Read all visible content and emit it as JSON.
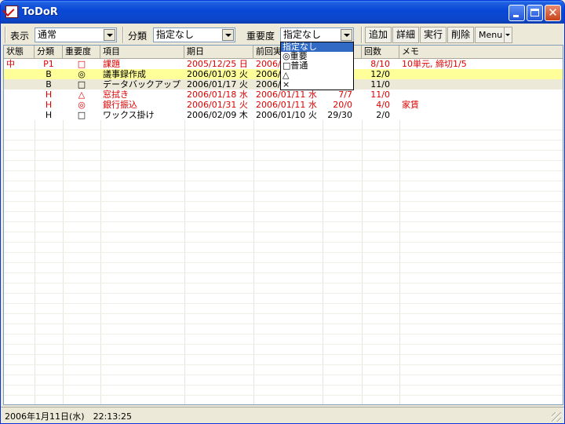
{
  "window": {
    "title": "ToDoR"
  },
  "toolbar": {
    "display_label": "表示",
    "display_value": "通常",
    "category_label": "分類",
    "category_value": "指定なし",
    "importance_label": "重要度",
    "importance_value": "指定なし",
    "add_label": "追加",
    "detail_label": "詳細",
    "run_label": "実行",
    "delete_label": "削除",
    "menu_label": "Menu"
  },
  "importance_dropdown": {
    "options": [
      "指定なし",
      "◎重要",
      "□普通",
      "△",
      "×"
    ]
  },
  "table": {
    "columns": [
      "状態",
      "分類",
      "重要度",
      "項目",
      "期日",
      "前回実",
      "",
      "回数",
      "メモ"
    ],
    "rows": [
      {
        "status": "中",
        "category": "P1",
        "importance": "□",
        "item": "課題",
        "due": "2005/12/25 日",
        "last": "2006/",
        "progress": "",
        "count": "8/10",
        "memo": "10単元, 締切1/5",
        "color": "#e00000",
        "bg": "#ffffff"
      },
      {
        "status": "",
        "category": "B",
        "importance": "◎",
        "item": "議事録作成",
        "due": "2006/01/03 火",
        "last": "2006/",
        "progress": "",
        "count": "12/0",
        "memo": "",
        "color": "#000000",
        "bg": "#ffff99"
      },
      {
        "status": "",
        "category": "B",
        "importance": "□",
        "item": "データバックアップ",
        "due": "2006/01/17 火",
        "last": "2006/",
        "progress": "",
        "count": "11/0",
        "memo": "",
        "color": "#000000",
        "bg": "#ece9d8"
      },
      {
        "status": "",
        "category": "H",
        "importance": "△",
        "item": "窓拭き",
        "due": "2006/01/18 水",
        "last": "2006/01/11 水",
        "progress": "7/7",
        "count": "11/0",
        "memo": "",
        "color": "#e00000",
        "bg": "#ffffff"
      },
      {
        "status": "",
        "category": "H",
        "importance": "◎",
        "item": "銀行振込",
        "due": "2006/01/31 火",
        "last": "2006/01/11 水",
        "progress": "20/0",
        "count": "4/0",
        "memo": "家賃",
        "color": "#e00000",
        "bg": "#ffffff"
      },
      {
        "status": "",
        "category": "H",
        "importance": "□",
        "item": "ワックス掛け",
        "due": "2006/02/09 木",
        "last": "2006/01/10 火",
        "progress": "29/30",
        "count": "2/0",
        "memo": "",
        "color": "#000000",
        "bg": "#ffffff"
      }
    ]
  },
  "statusbar": {
    "text": "2006年1月11日(水)　22:13:25"
  }
}
